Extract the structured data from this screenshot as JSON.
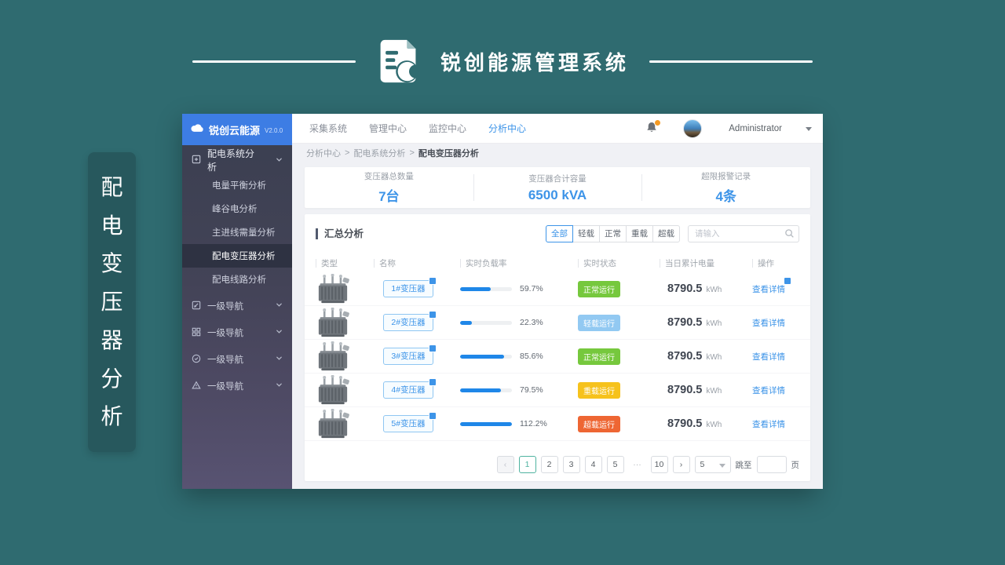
{
  "banner": {
    "title": "锐创能源管理系统",
    "vertical_chars": [
      "配",
      "电",
      "变",
      "压",
      "器",
      "分",
      "析"
    ]
  },
  "sidebar": {
    "brand": "锐创云能源",
    "version": "V2.0.0",
    "group": {
      "label": "配电系统分析"
    },
    "sub_items": [
      "电量平衡分析",
      "峰谷电分析",
      "主进线需量分析",
      "配电变压器分析",
      "配电线路分析"
    ],
    "active_item": "配电变压器分析",
    "nav_groups": [
      {
        "label": "一级导航",
        "icon": "edit-icon"
      },
      {
        "label": "一级导航",
        "icon": "grid-icon"
      },
      {
        "label": "一级导航",
        "icon": "check-circle-icon"
      },
      {
        "label": "一级导航",
        "icon": "warning-icon"
      }
    ]
  },
  "topnav": {
    "items": [
      "采集系统",
      "管理中心",
      "监控中心",
      "分析中心"
    ],
    "active_item": "分析中心",
    "username": "Administrator"
  },
  "breadcrumb": {
    "items": [
      "分析中心",
      "配电系统分析"
    ],
    "separator": ">",
    "current": "配电变压器分析"
  },
  "stats": {
    "cards": [
      {
        "label": "变压器总数量",
        "value": "7台"
      },
      {
        "label": "变压器合计容量",
        "value": "6500 kVA"
      },
      {
        "label": "超限报警记录",
        "value": "4条"
      }
    ]
  },
  "summary": {
    "title": "汇总分析",
    "filters": [
      "全部",
      "轻载",
      "正常",
      "重载",
      "超载"
    ],
    "active_filter": "全部",
    "search_placeholder": "请输入"
  },
  "table": {
    "headers": [
      "类型",
      "名称",
      "实时负载率",
      "实时状态",
      "当日累计电量",
      "操作"
    ],
    "energy_unit": "kWh",
    "action_label": "查看详情",
    "rows": [
      {
        "name": "1#变压器",
        "load_label": "59.7%",
        "fill_style": "width:59.7%",
        "status": "正常运行",
        "status_type": "normal",
        "energy": "8790.5"
      },
      {
        "name": "2#变压器",
        "load_label": "22.3%",
        "fill_style": "width:22.3%",
        "status": "轻载运行",
        "status_type": "light",
        "energy": "8790.5"
      },
      {
        "name": "3#变压器",
        "load_label": "85.6%",
        "fill_style": "width:85.6%",
        "status": "正常运行",
        "status_type": "normal",
        "energy": "8790.5"
      },
      {
        "name": "4#变压器",
        "load_label": "79.5%",
        "fill_style": "width:79.5%",
        "status": "重载运行",
        "status_type": "heavy",
        "energy": "8790.5"
      },
      {
        "name": "5#变压器",
        "load_label": "112.2%",
        "fill_style": "width:100%",
        "status": "超载运行",
        "status_type": "overload",
        "energy": "8790.5"
      }
    ]
  },
  "pagination": {
    "prev": "‹",
    "next": "›",
    "pages": [
      "1",
      "2",
      "3",
      "4",
      "5",
      "···",
      "10"
    ],
    "active_page": "1",
    "page_size": "5",
    "jump_label": "跳至",
    "page_unit": "页"
  },
  "colors": {
    "background_teal": "#2f6b70",
    "accent_blue": "#3d94e8",
    "progress_blue": "#1f87e8",
    "status_normal_green": "#76c83d",
    "status_light_blue": "#92c9f2",
    "status_heavy_yellow": "#f6c21c",
    "status_overload_orange": "#ee6633",
    "pagination_active_teal": "#4fb3a0"
  }
}
